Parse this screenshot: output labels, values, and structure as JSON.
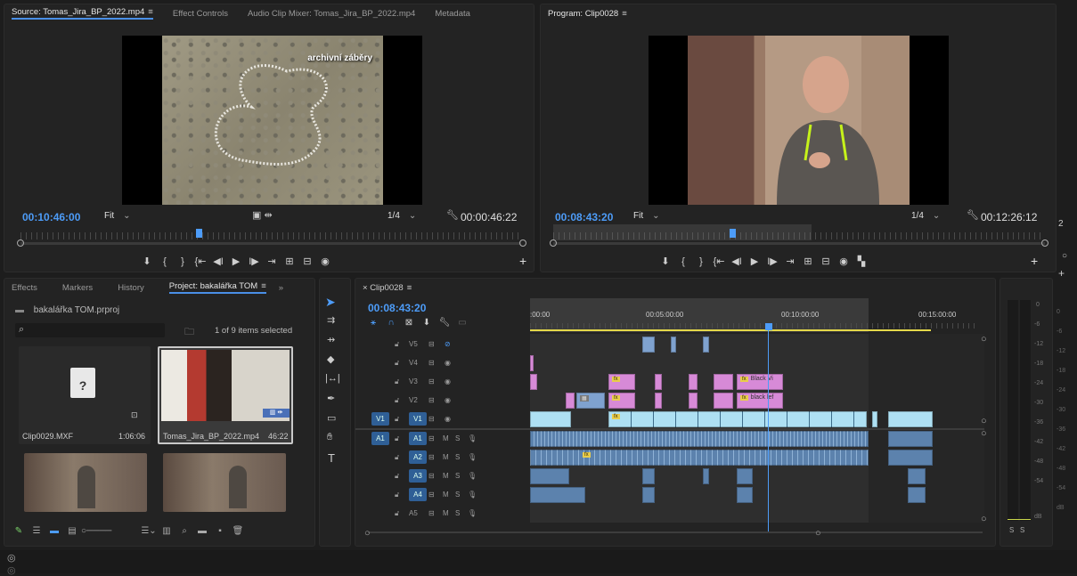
{
  "source_panel": {
    "tabs": [
      "Source: Tomas_Jira_BP_2022.mp4",
      "Effect Controls",
      "Audio Clip Mixer: Tomas_Jira_BP_2022.mp4",
      "Metadata"
    ],
    "overlay_caption": "archivní záběry",
    "timecode": "00:10:46:00",
    "fit": "Fit",
    "resolution": "1/4",
    "duration": "00:00:46:22"
  },
  "program_panel": {
    "title": "Program: Clip0028",
    "timecode": "00:08:43:20",
    "fit": "Fit",
    "resolution": "1/4",
    "duration": "00:12:26:12"
  },
  "project_panel": {
    "tabs": [
      "Effects",
      "Markers",
      "History",
      "Project: bakalářka TOM"
    ],
    "overflow": "»",
    "project_file": "bakalářka TOM.prproj",
    "selection_info": "1 of 9 items selected",
    "items": [
      {
        "name": "Clip0029.MXF",
        "duration": "1:06:06"
      },
      {
        "name": "Tomas_Jira_BP_2022.mp4",
        "duration": "46:22"
      },
      {
        "name": "",
        "duration": ""
      },
      {
        "name": "",
        "duration": ""
      }
    ]
  },
  "timeline": {
    "sequence": "Clip0028",
    "timecode": "00:08:43:20",
    "ruler": [
      ":00:00",
      "00:05:00:00",
      "00:10:00:00",
      "00:15:00:00"
    ],
    "video_tracks": [
      "V5",
      "V4",
      "V3",
      "V2",
      "V1"
    ],
    "audio_tracks": [
      "A1",
      "A2",
      "A3",
      "A4",
      "A5"
    ],
    "source_patch_v": "V1",
    "source_patch_a": "A1",
    "mute": "M",
    "solo": "S",
    "clip_labels": [
      "Black Vi",
      "black lef"
    ]
  },
  "audio_meter": {
    "scale": [
      "0",
      "-6",
      "-12",
      "-18",
      "-24",
      "-30",
      "-36",
      "-42",
      "-48",
      "-54",
      "dB"
    ],
    "solo_buttons": [
      "S",
      "S"
    ]
  },
  "edge_labels": [
    "2"
  ],
  "colors": {
    "accent": "#4a8fe7",
    "video_clip": "#aee0f3",
    "audio_clip": "#5c82ad",
    "pink_clip": "#d78ad7",
    "fx_badge": "#e9cd4c"
  },
  "icons": [
    "selection-tool-icon",
    "track-select-icon",
    "ripple-edit-icon",
    "razor-icon",
    "slip-icon",
    "pen-icon",
    "rectangle-icon",
    "hand-icon",
    "type-icon",
    "magnet-icon",
    "wrench-icon",
    "marker-icon",
    "camera-icon",
    "play-icon",
    "step-back-icon",
    "step-forward-icon",
    "lock-icon",
    "eye-icon",
    "mic-icon",
    "search-icon",
    "new-bin-icon",
    "trash-icon"
  ]
}
